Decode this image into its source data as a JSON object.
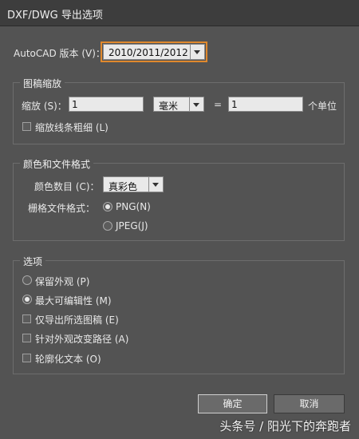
{
  "window": {
    "title": "DXF/DWG 导出选项"
  },
  "version": {
    "label": "AutoCAD 版本 (V)：",
    "selected": "2010/2011/2012"
  },
  "scaling": {
    "group_title": "图稿缩放",
    "scale_label": "缩放 (S)：",
    "scale_value": "1",
    "unit_selected": "毫米",
    "equals": "=",
    "result_value": "1",
    "result_unit": "个单位",
    "scale_lines_label": "缩放线条粗细 (L)",
    "scale_lines_checked": false
  },
  "color_format": {
    "group_title": "颜色和文件格式",
    "num_colors_label": "颜色数目 (C)：",
    "num_colors_selected": "真彩色",
    "raster_label": "栅格文件格式：",
    "png_label": "PNG(N)",
    "png_selected": true,
    "jpeg_label": "JPEG(J)",
    "jpeg_selected": false
  },
  "options": {
    "group_title": "选项",
    "preserve_appearance_label": "保留外观 (P)",
    "preserve_appearance_selected": false,
    "max_editability_label": "最大可编辑性 (M)",
    "max_editability_selected": true,
    "export_selected_label": "仅导出所选图稿 (E)",
    "export_selected_checked": false,
    "alter_paths_label": "针对外观改变路径 (A)",
    "alter_paths_checked": false,
    "outline_text_label": "轮廓化文本 (O)",
    "outline_text_checked": false
  },
  "buttons": {
    "ok": "确定",
    "cancel": "取消"
  },
  "watermark": "头条号 / 阳光下的奔跑者"
}
